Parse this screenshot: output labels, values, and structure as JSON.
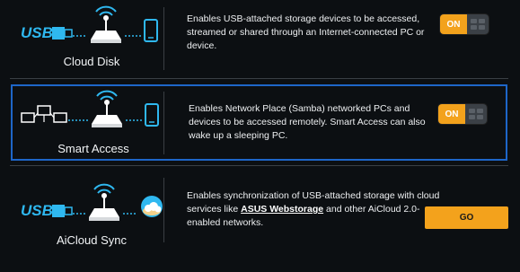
{
  "features": {
    "cloud_disk": {
      "title": "Cloud Disk",
      "description": "Enables USB-attached storage devices to be accessed, streamed or shared through an Internet-connected PC or device.",
      "toggle_label": "ON",
      "icons": [
        "usb-icon",
        "router-icon",
        "phone-icon"
      ]
    },
    "smart_access": {
      "title": "Smart Access",
      "description": "Enables Network Place (Samba) networked PCs and devices to be accessed remotely. Smart Access can also wake up a sleeping PC.",
      "toggle_label": "ON",
      "icons": [
        "network-pcs-icon",
        "router-icon",
        "phone-icon"
      ]
    },
    "aicloud_sync": {
      "title": "AiCloud Sync",
      "description_before": "Enables synchronization of USB-attached storage with cloud services like ",
      "description_link": "ASUS Webstorage",
      "description_after": " and other AiCloud 2.0-enabled networks.",
      "button_label": "GO",
      "icons": [
        "usb-icon",
        "router-icon",
        "cloud-icon"
      ]
    }
  },
  "colors": {
    "accent": "#f3a21c",
    "highlight_border": "#1e66c8",
    "icon_blue": "#2fb8f0",
    "background": "#0c0f12"
  }
}
